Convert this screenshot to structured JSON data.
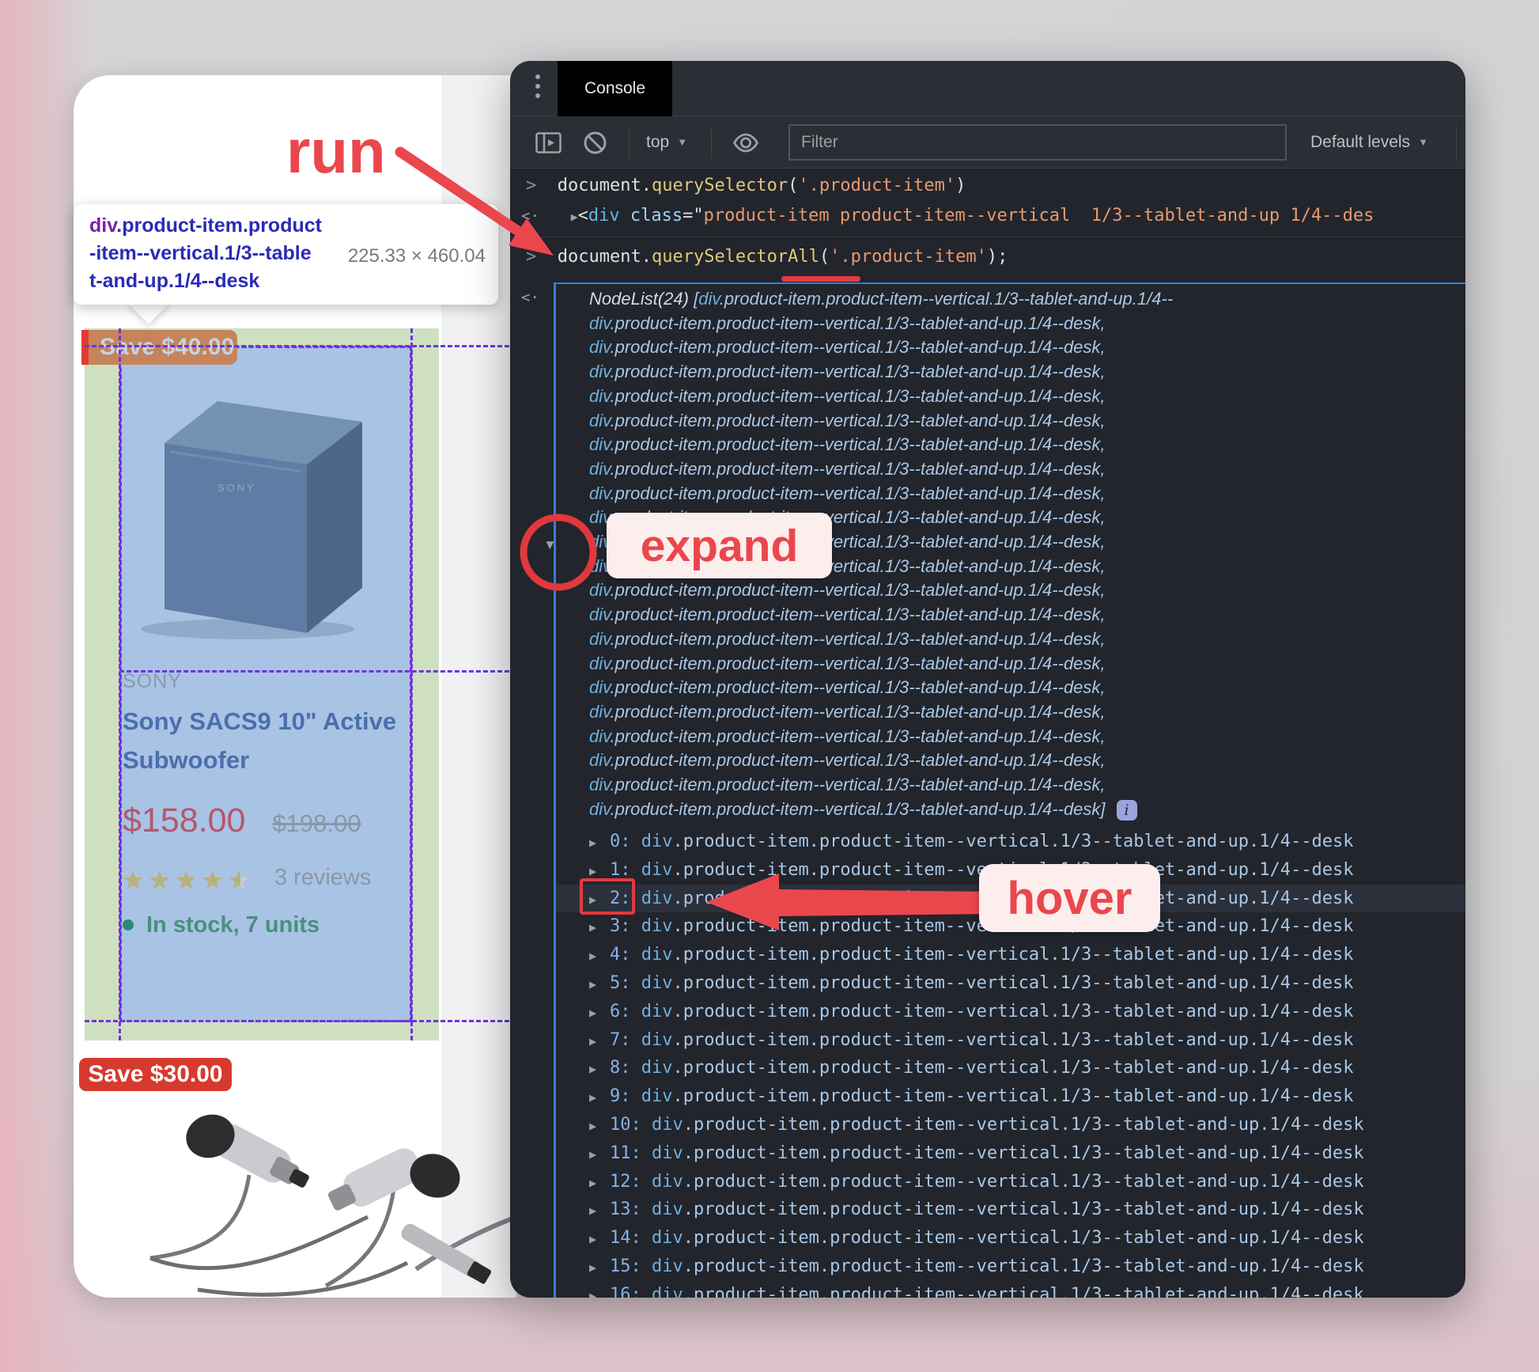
{
  "colors": {
    "annotation_red": "#ea474d",
    "badge_red": "#d63a2e",
    "highlight_blue": "#a9c3e4",
    "highlight_green": "#cfe0c0",
    "guide_purple": "#6f35dd",
    "selection_blue": "#3b7cd8",
    "console_bg": "#22252c"
  },
  "annotations": {
    "run": "run",
    "expand": "expand",
    "hover": "hover"
  },
  "inspector_tooltip": {
    "selector_line1_tag": "div",
    "selector_line1_rest": ".product-item.product",
    "selector_line2": "-item--vertical.1/3--table",
    "selector_line3": "t-and-up.1/4--desk",
    "dimensions": "225.33 × 460.04"
  },
  "page": {
    "product_highlighted": {
      "badge": "Save $40.00",
      "brand": "SONY",
      "speaker_logo": "SONY",
      "title_line1": "Sony SACS9 10\" Active",
      "title_line2": "Subwoofer",
      "sale_price": "$158.00",
      "original_price": "$198.00",
      "stars": "★★★★★",
      "rating_fraction": "90%",
      "reviews": "3 reviews",
      "stock": "In stock, 7 units"
    },
    "product_next": {
      "badge": "Save $30.00"
    }
  },
  "console": {
    "tab": "Console",
    "toolbar": {
      "context": "top",
      "filter_placeholder": "Filter",
      "levels": "Default levels"
    },
    "command1": {
      "prompt": ">",
      "object": "document",
      "dot": ".",
      "method": "querySelector",
      "paren_open": "(",
      "string_arg": "'.product-item'",
      "paren_close": ")"
    },
    "result1": {
      "return_icon": "<·",
      "expander": "▶",
      "tag_open": "<",
      "tag": "div",
      "attr": " class",
      "eq": "=\"",
      "value": "product-item product-item--vertical  1/3--tablet-and-up 1/4--des"
    },
    "command2": {
      "prompt": ">",
      "object": "document",
      "dot": ".",
      "method": "querySelectorAll",
      "paren_open": "(",
      "string_arg": "'.product-item'",
      "paren_close": ");"
    },
    "nodelist": {
      "return_icon": "<·",
      "expander": "▼",
      "label": "NodeList(24) ",
      "bracket_open": "[",
      "item_tag": "div",
      "item_rest": ".product-item.product-item--vertical.1/3--tablet-and-up.1/4--desk",
      "first_line_rest": ".product-item.product-item--vertical.1/3--tablet-and-up.1/4--",
      "wrapped_count": 20,
      "bracket_close": "]",
      "info_icon": "i"
    },
    "expanded_items": {
      "expander": "▶",
      "count": 17,
      "item_tag": "div",
      "item_rest": ".product-item.product-item--vertical.1/3--tablet-and-up.1/4--desk",
      "highlight_index": 2
    }
  }
}
